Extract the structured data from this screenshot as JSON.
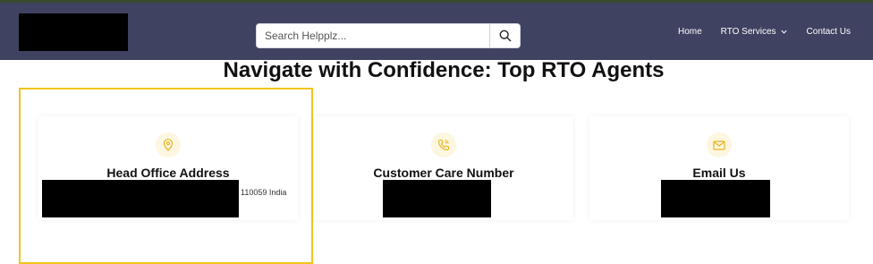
{
  "header": {
    "search": {
      "placeholder": "Search Helpplz..."
    },
    "nav": {
      "home": "Home",
      "rto_services": "RTO Services",
      "contact": "Contact Us"
    }
  },
  "main": {
    "headline": "Navigate with Confidence: Top RTO Agents",
    "cards": [
      {
        "title": "Head Office Address",
        "icon": "map-pin-icon",
        "address_tail": "110059 India"
      },
      {
        "title": "Customer Care Number",
        "icon": "phone-icon"
      },
      {
        "title": "Email Us",
        "icon": "mail-icon"
      }
    ]
  },
  "colors": {
    "navbar": "#3f4260",
    "accent": "#f2c31a",
    "icon_bg": "#fdf6e0"
  }
}
